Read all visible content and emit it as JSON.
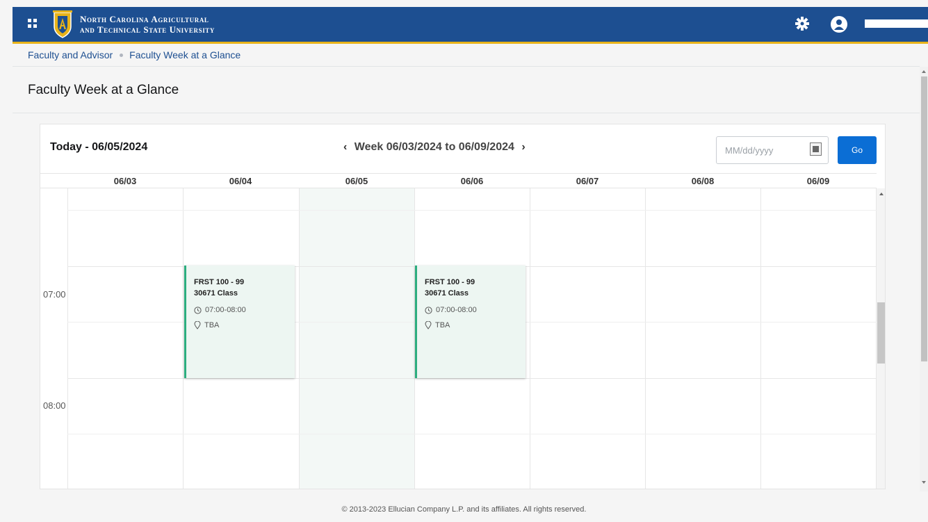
{
  "header": {
    "university_line1": "North Carolina Agricultural",
    "university_line2": "and Technical State University",
    "brand_color": "#1d4f91",
    "accent_color": "#e8b31a",
    "icons": [
      "grid-menu-icon",
      "university-logo",
      "gear-icon",
      "user-icon"
    ]
  },
  "breadcrumb": {
    "items": [
      "Faculty and Advisor",
      "Faculty Week at a Glance"
    ]
  },
  "page": {
    "title": "Faculty Week at a Glance"
  },
  "calendar": {
    "today_label": "Today - 06/05/2024",
    "week_label": "Week 06/03/2024 to 06/09/2024",
    "prev_icon": "‹",
    "next_icon": "›",
    "date_placeholder": "MM/dd/yyyy",
    "go_label": "Go",
    "days": [
      "06/03",
      "06/04",
      "06/05",
      "06/06",
      "06/07",
      "06/08",
      "06/09"
    ],
    "today_day": "06/05",
    "times": [
      "07:00",
      "08:00"
    ],
    "events": [
      {
        "day": "06/04",
        "course": "FRST 100 - 99",
        "crn_type": "30671 Class",
        "time": "07:00-08:00",
        "location": "TBA"
      },
      {
        "day": "06/06",
        "course": "FRST 100 - 99",
        "crn_type": "30671 Class",
        "time": "07:00-08:00",
        "location": "TBA"
      }
    ],
    "event_accent_color": "#2dae7f",
    "go_button_color": "#0b6ed5"
  },
  "footer": {
    "text": "© 2013-2023 Ellucian Company L.P. and its affiliates. All rights reserved."
  }
}
